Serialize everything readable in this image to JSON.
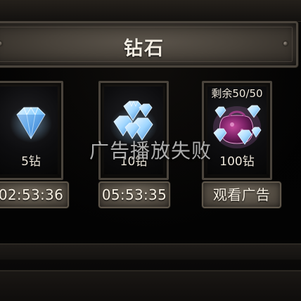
{
  "panel": {
    "title": "钻石"
  },
  "cards": [
    {
      "label": "5钻",
      "timer": "02:53:36",
      "icon": "diamond-icon"
    },
    {
      "label": "10钻",
      "timer": "05:53:35",
      "icon": "diamond-pile-icon"
    },
    {
      "top_label": "剩余50/50",
      "label": "100钻",
      "button": "观看广告",
      "icon": "diamond-bag-icon"
    }
  ],
  "toast": {
    "message": "广告播放失败"
  },
  "colors": {
    "frame": "#4a443c",
    "button": "#544d43",
    "text": "#f3ede2",
    "diamond": "#7fc6ff"
  }
}
